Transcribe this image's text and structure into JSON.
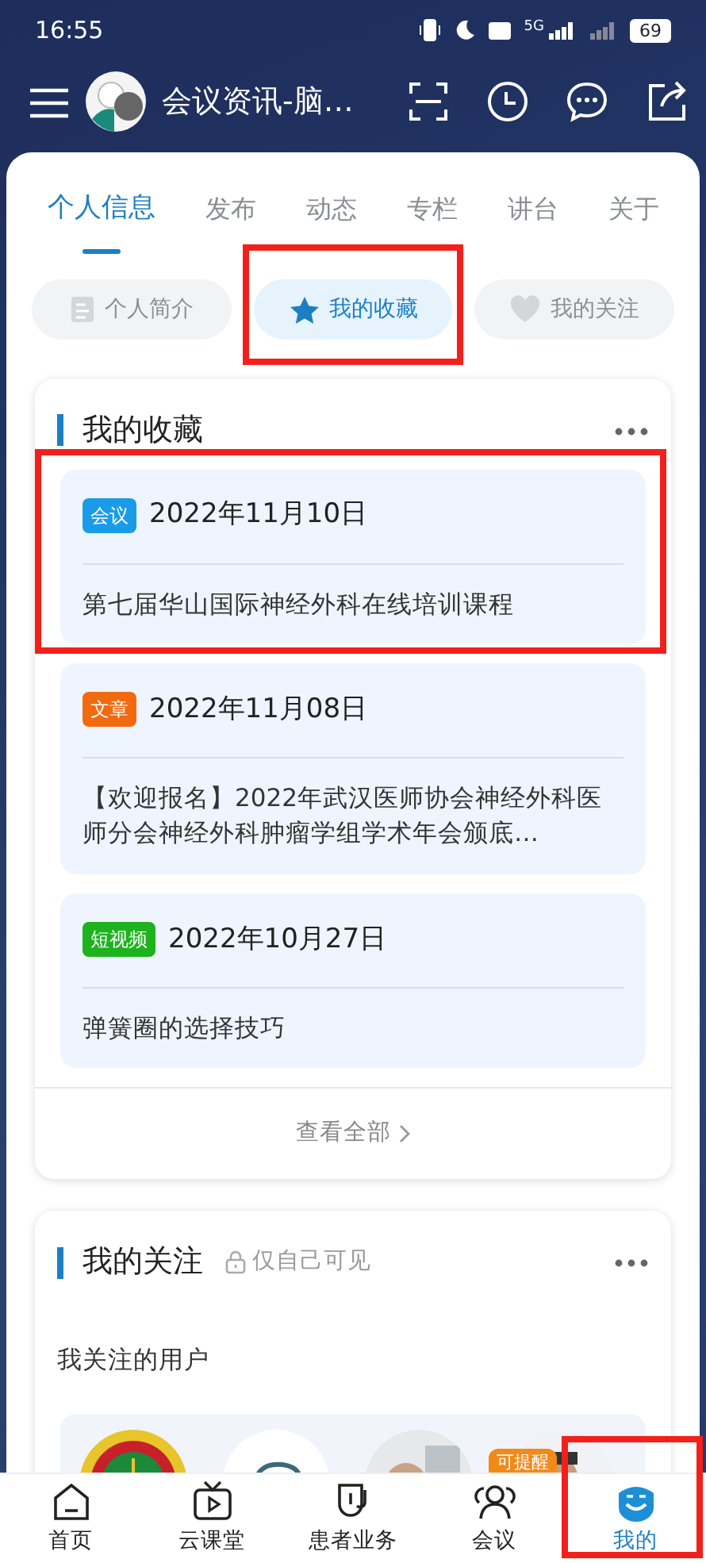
{
  "status_bar": {
    "time": "16:55",
    "network": "5G",
    "battery": "69"
  },
  "header": {
    "title": "会议资讯-脑…"
  },
  "tabs": [
    {
      "label": "个人信息",
      "selected": true
    },
    {
      "label": "发布",
      "selected": false
    },
    {
      "label": "动态",
      "selected": false
    },
    {
      "label": "专栏",
      "selected": false
    },
    {
      "label": "讲台",
      "selected": false
    },
    {
      "label": "关于",
      "selected": false
    }
  ],
  "chips": [
    {
      "label": "个人简介",
      "selected": false,
      "highlighted": false
    },
    {
      "label": "我的收藏",
      "selected": true,
      "highlighted": true
    },
    {
      "label": "我的关注",
      "selected": false,
      "highlighted": false
    }
  ],
  "favorites": {
    "title": "我的收藏",
    "items": [
      {
        "tag": "会议",
        "color": "#1a9be8",
        "date": "2022年11月10日",
        "text": "第七届华山国际神经外科在线培训课程",
        "highlighted": true
      },
      {
        "tag": "文章",
        "color": "#f26a10",
        "date": "2022年11月08日",
        "text": "【欢迎报名】2022年武汉医师协会神经外科医师分会神经外科肿瘤学组学术年会颁底…",
        "highlighted": false
      },
      {
        "tag": "短视频",
        "color": "#1eb21e",
        "date": "2022年10月27日",
        "text": "弹簧圈的选择技巧",
        "highlighted": false
      }
    ],
    "view_all": "查看全部"
  },
  "follows": {
    "title": "我的关注",
    "privacy": "仅自己可见",
    "subtitle": "我关注的用户",
    "users": [
      {
        "kind": "picture"
      },
      {
        "kind": "picture"
      },
      {
        "kind": "picture"
      },
      {
        "kind": "picture",
        "badge": "可提醒"
      }
    ]
  },
  "bottom_nav": [
    {
      "label": "首页",
      "selected": false,
      "highlighted": false
    },
    {
      "label": "云课堂",
      "selected": false,
      "highlighted": false
    },
    {
      "label": "患者业务",
      "selected": false,
      "highlighted": false
    },
    {
      "label": "会议",
      "selected": false,
      "highlighted": false
    },
    {
      "label": "我的",
      "selected": true,
      "highlighted": true
    }
  ]
}
